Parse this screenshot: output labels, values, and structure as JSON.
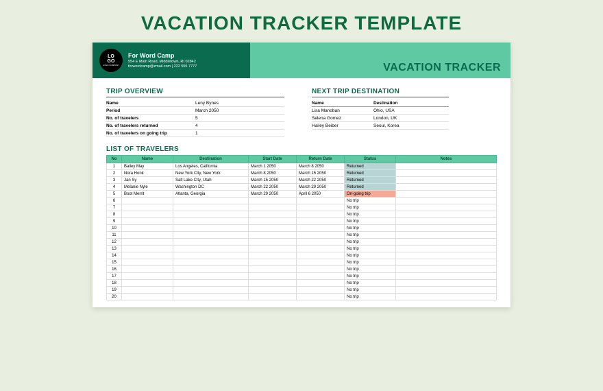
{
  "pageTitle": "VACATION TRACKER TEMPLATE",
  "header": {
    "logoTop": "LO",
    "logoBottom": "GO",
    "logoSub": "LOGO COMPANY",
    "companyName": "For Word Camp",
    "address": "554 E Main Road, Middletown, RI 02842",
    "contact": "forwordcamp@zmail.com | 222 555 7777",
    "trackerTitle": "VACATION TRACKER"
  },
  "overview": {
    "title": "TRIP OVERVIEW",
    "rows": [
      {
        "label": "Name",
        "value": "Leny Bynes"
      },
      {
        "label": "Period",
        "value": "March 2050"
      },
      {
        "label": "No. of travelers",
        "value": "5"
      },
      {
        "label": "No. of travelers returned",
        "value": "4"
      },
      {
        "label": "No. of travelers on going trip",
        "value": "1"
      }
    ]
  },
  "nextTrip": {
    "title": "NEXT TRIP DESTINATION",
    "headName": "Name",
    "headDest": "Destination",
    "rows": [
      {
        "name": "Lisa Manoban",
        "dest": "Ohio, USA"
      },
      {
        "name": "Selena Gomez",
        "dest": "London, UK"
      },
      {
        "name": "Hailey Beiber",
        "dest": "Seoul, Korea"
      }
    ]
  },
  "travelers": {
    "title": "LIST OF TRAVELERS",
    "columns": [
      "No",
      "Name",
      "Destination",
      "Start Date",
      "Return Date",
      "Status",
      "Notes"
    ],
    "rows": [
      {
        "no": "1",
        "name": "Bailey May",
        "dest": "Los Angeles, California",
        "start": "March 1 2050",
        "return": "March 8 2050",
        "status": "Returned",
        "statusClass": "status-returned",
        "notes": ""
      },
      {
        "no": "2",
        "name": "Nora Honk",
        "dest": "New York City, New York",
        "start": "March 8 2050",
        "return": "March 15 2050",
        "status": "Returned",
        "statusClass": "status-returned",
        "notes": ""
      },
      {
        "no": "3",
        "name": "Jan Sy",
        "dest": "Salt Lake City, Utah",
        "start": "March 15 2050",
        "return": "March 22 2050",
        "status": "Returned",
        "statusClass": "status-returned",
        "notes": ""
      },
      {
        "no": "4",
        "name": "Melanie Nyle",
        "dest": "Washington DC",
        "start": "March 22 2050",
        "return": "March 29 2050",
        "status": "Returned",
        "statusClass": "status-returned",
        "notes": ""
      },
      {
        "no": "5",
        "name": "Boot Merrit",
        "dest": "Atlanta, Georgia",
        "start": "March 29 2050",
        "return": "April 6 2050",
        "status": "On-going trip",
        "statusClass": "status-ongoing",
        "notes": ""
      },
      {
        "no": "6",
        "name": "",
        "dest": "",
        "start": "",
        "return": "",
        "status": "No trip",
        "statusClass": "status-notrip",
        "notes": ""
      },
      {
        "no": "7",
        "name": "",
        "dest": "",
        "start": "",
        "return": "",
        "status": "No trip",
        "statusClass": "status-notrip",
        "notes": ""
      },
      {
        "no": "8",
        "name": "",
        "dest": "",
        "start": "",
        "return": "",
        "status": "No trip",
        "statusClass": "status-notrip",
        "notes": ""
      },
      {
        "no": "9",
        "name": "",
        "dest": "",
        "start": "",
        "return": "",
        "status": "No trip",
        "statusClass": "status-notrip",
        "notes": ""
      },
      {
        "no": "10",
        "name": "",
        "dest": "",
        "start": "",
        "return": "",
        "status": "No trip",
        "statusClass": "status-notrip",
        "notes": ""
      },
      {
        "no": "11",
        "name": "",
        "dest": "",
        "start": "",
        "return": "",
        "status": "No trip",
        "statusClass": "status-notrip",
        "notes": ""
      },
      {
        "no": "12",
        "name": "",
        "dest": "",
        "start": "",
        "return": "",
        "status": "No trip",
        "statusClass": "status-notrip",
        "notes": ""
      },
      {
        "no": "13",
        "name": "",
        "dest": "",
        "start": "",
        "return": "",
        "status": "No trip",
        "statusClass": "status-notrip",
        "notes": ""
      },
      {
        "no": "14",
        "name": "",
        "dest": "",
        "start": "",
        "return": "",
        "status": "No trip",
        "statusClass": "status-notrip",
        "notes": ""
      },
      {
        "no": "15",
        "name": "",
        "dest": "",
        "start": "",
        "return": "",
        "status": "No trip",
        "statusClass": "status-notrip",
        "notes": ""
      },
      {
        "no": "16",
        "name": "",
        "dest": "",
        "start": "",
        "return": "",
        "status": "No trip",
        "statusClass": "status-notrip",
        "notes": ""
      },
      {
        "no": "17",
        "name": "",
        "dest": "",
        "start": "",
        "return": "",
        "status": "No trip",
        "statusClass": "status-notrip",
        "notes": ""
      },
      {
        "no": "18",
        "name": "",
        "dest": "",
        "start": "",
        "return": "",
        "status": "No trip",
        "statusClass": "status-notrip",
        "notes": ""
      },
      {
        "no": "19",
        "name": "",
        "dest": "",
        "start": "",
        "return": "",
        "status": "No trip",
        "statusClass": "status-notrip",
        "notes": ""
      },
      {
        "no": "20",
        "name": "",
        "dest": "",
        "start": "",
        "return": "",
        "status": "No trip",
        "statusClass": "status-notrip",
        "notes": ""
      }
    ]
  }
}
